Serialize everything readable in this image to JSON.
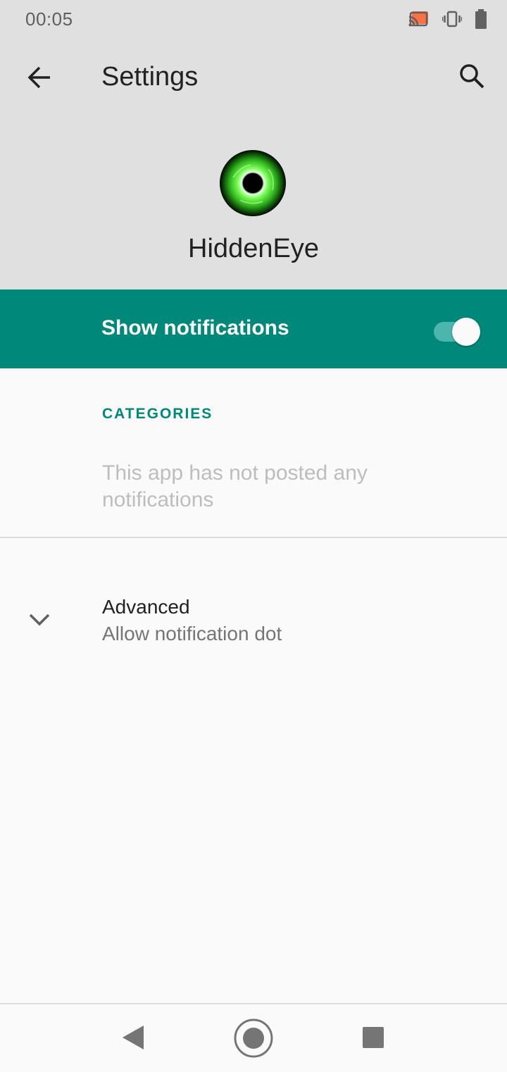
{
  "status_bar": {
    "time": "00:05",
    "icons": [
      "cast-icon",
      "vibrate-icon",
      "battery-icon"
    ]
  },
  "app_bar": {
    "title": "Settings",
    "back_icon": "arrow-back-icon",
    "search_icon": "search-icon"
  },
  "app_header": {
    "app_name": "HiddenEye",
    "icon": "green-eye-app-icon"
  },
  "master_switch": {
    "label": "Show notifications",
    "checked": true,
    "background_color": "#00897b"
  },
  "categories": {
    "header": "CATEGORIES",
    "empty_text": "This app has not posted any notifications"
  },
  "advanced": {
    "title": "Advanced",
    "summary": "Allow notification dot",
    "icon": "chevron-down-icon"
  },
  "nav_bar": {
    "buttons": [
      "nav-back-icon",
      "nav-home-icon",
      "nav-recents-icon"
    ]
  },
  "colors": {
    "accent": "#00897b",
    "header_bg": "#e0e0e0",
    "page_bg": "#fafafa"
  }
}
